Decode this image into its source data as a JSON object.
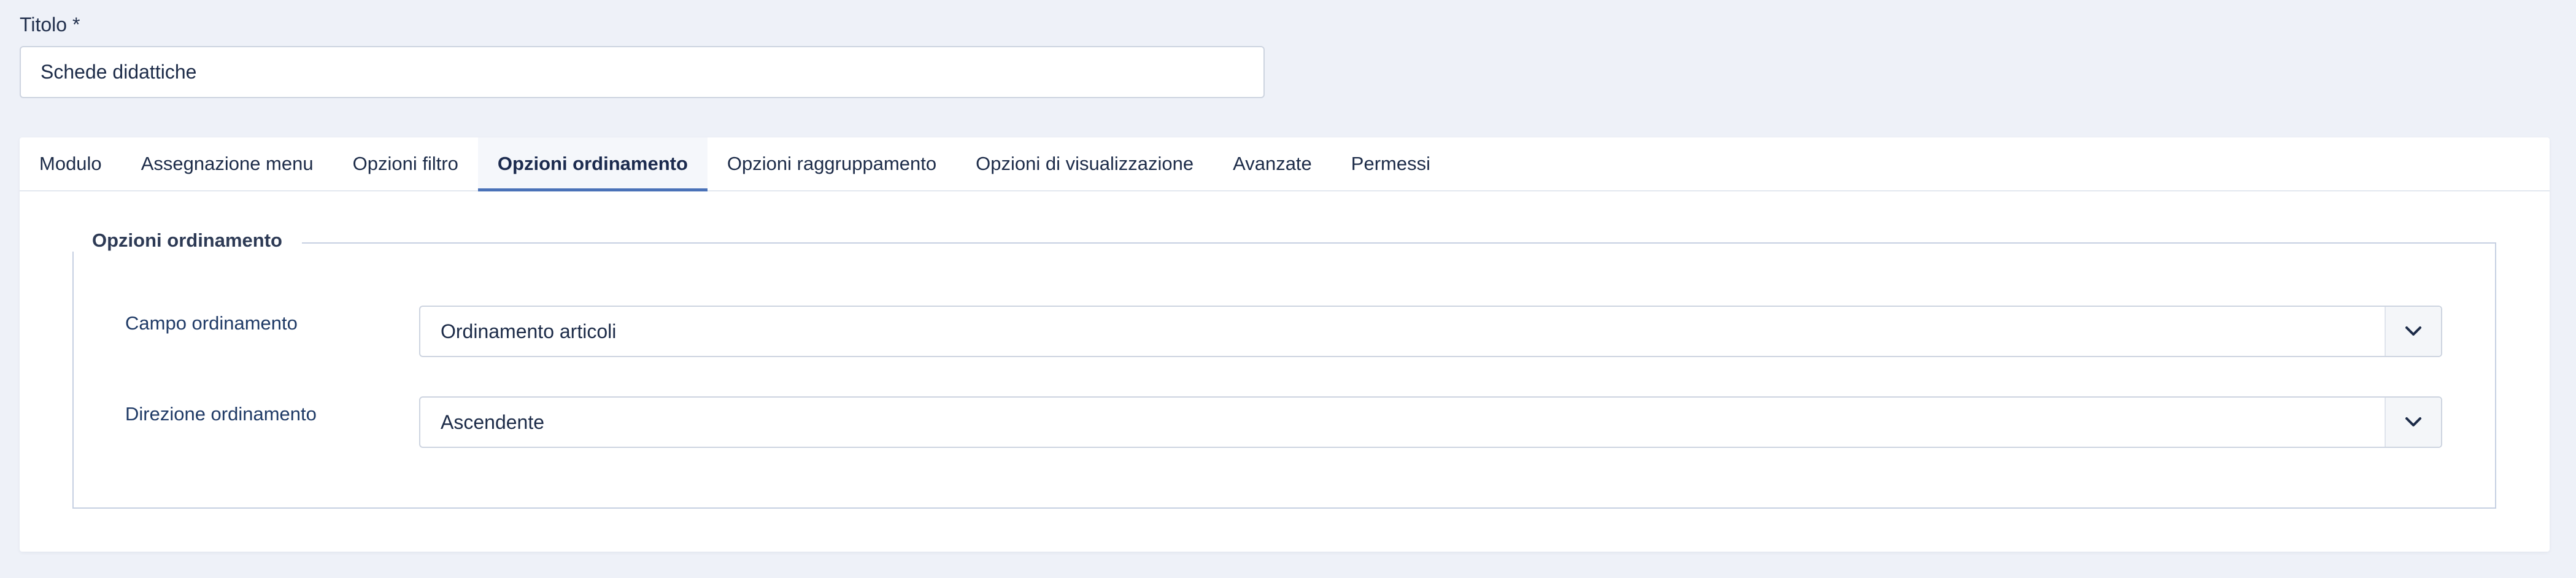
{
  "title_field": {
    "label": "Titolo *",
    "value": "Schede didattiche"
  },
  "tabs": [
    {
      "label": "Modulo",
      "active": false
    },
    {
      "label": "Assegnazione menu",
      "active": false
    },
    {
      "label": "Opzioni filtro",
      "active": false
    },
    {
      "label": "Opzioni ordinamento",
      "active": true
    },
    {
      "label": "Opzioni raggruppamento",
      "active": false
    },
    {
      "label": "Opzioni di visualizzazione",
      "active": false
    },
    {
      "label": "Avanzate",
      "active": false
    },
    {
      "label": "Permessi",
      "active": false
    }
  ],
  "fieldset": {
    "legend": "Opzioni ordinamento",
    "fields": [
      {
        "label": "Campo ordinamento",
        "value": "Ordinamento articoli"
      },
      {
        "label": "Direzione ordinamento",
        "value": "Ascendente"
      }
    ]
  },
  "colors": {
    "background": "#eef1f8",
    "accent": "#4a72b8",
    "text": "#1c2b48"
  },
  "icons": {
    "dropdown": "chevron-down-icon"
  }
}
